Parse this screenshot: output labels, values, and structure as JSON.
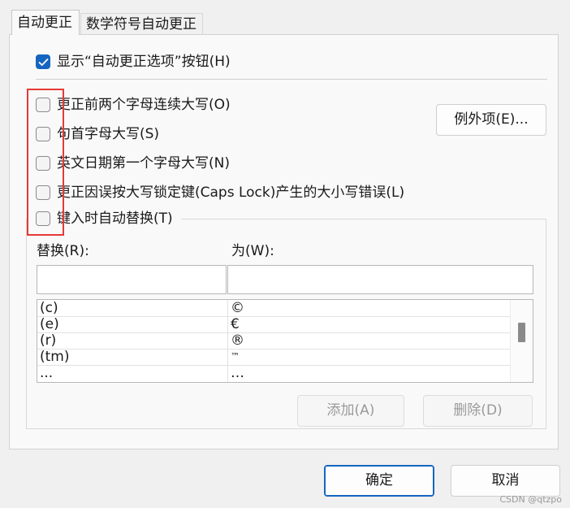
{
  "tabs": [
    {
      "label": "自动更正"
    },
    {
      "label": "数学符号自动更正"
    }
  ],
  "show_button_option": {
    "label": "显示“自动更正选项”按钮(H)",
    "checked": true
  },
  "options": [
    {
      "label": "更正前两个字母连续大写(O)",
      "checked": false
    },
    {
      "label": "句首字母大写(S)",
      "checked": false
    },
    {
      "label": "英文日期第一个字母大写(N)",
      "checked": false
    },
    {
      "label": "更正因误按大写锁定键(Caps Lock)产生的大小写错误(L)",
      "checked": false
    },
    {
      "label": "键入时自动替换(T)",
      "checked": false
    }
  ],
  "exceptions_button": "例外项(E)...",
  "replace": {
    "replace_label": "替换(R):",
    "with_label": "为(W):",
    "replace_value": "",
    "with_value": "",
    "rows": [
      {
        "from": "(c)",
        "to": "©"
      },
      {
        "from": "(e)",
        "to": "€"
      },
      {
        "from": "(r)",
        "to": "®"
      },
      {
        "from": "(tm)",
        "to": "™"
      },
      {
        "from": "...",
        "to": "…"
      }
    ],
    "add_button": "添加(A)",
    "delete_button": "删除(D)"
  },
  "footer": {
    "ok_button": "确定",
    "cancel_button": "取消"
  },
  "watermark": "CSDN @qtzpo",
  "colors": {
    "accent": "#1565c0",
    "highlight": "#e53935"
  }
}
